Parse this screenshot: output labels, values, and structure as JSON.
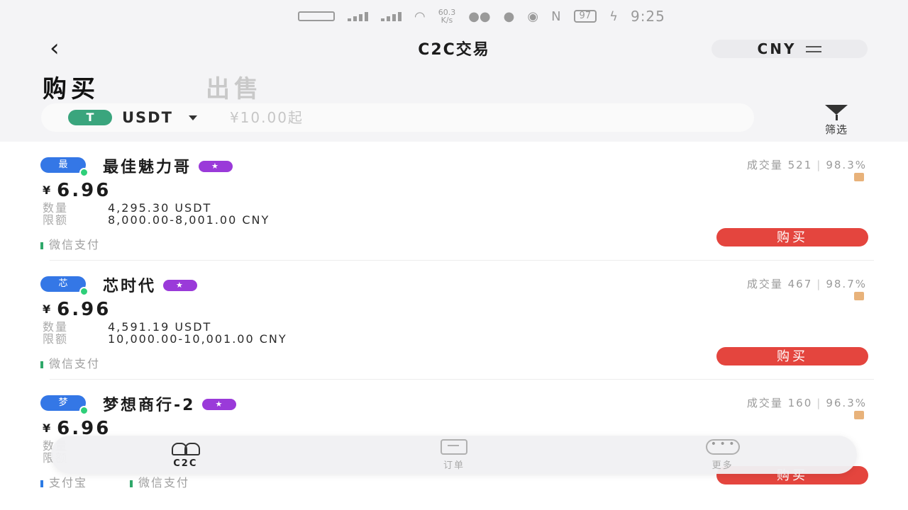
{
  "status_bar": {
    "speed": "60.3",
    "speed_unit": "K/s",
    "battery": "97",
    "time": "9:25"
  },
  "header": {
    "title": "C2C交易",
    "currency": "CNY"
  },
  "tabs": {
    "buy": "购买",
    "sell": "出售"
  },
  "search": {
    "coin_icon_text": "T",
    "coin": "USDT",
    "amount_placeholder": "¥10.00起",
    "filter_label": "筛选"
  },
  "ads": [
    {
      "avatar_text": "最",
      "merchant": "最佳魅力哥",
      "trade_label": "成交量",
      "trades": "521",
      "rate": "98.3%",
      "price_symbol": "¥",
      "price": "6.96",
      "qty_label": "数量",
      "quantity": "4,295.30 USDT",
      "limit_label": "限额",
      "limit": "8,000.00-8,001.00 CNY",
      "payments": [
        "微信支付"
      ],
      "button": "购买"
    },
    {
      "avatar_text": "芯",
      "merchant": "芯时代",
      "trade_label": "成交量",
      "trades": "467",
      "rate": "98.7%",
      "price_symbol": "¥",
      "price": "6.96",
      "qty_label": "数量",
      "quantity": "4,591.19 USDT",
      "limit_label": "限额",
      "limit": "10,000.00-10,001.00 CNY",
      "payments": [
        "微信支付"
      ],
      "button": "购买"
    },
    {
      "avatar_text": "梦",
      "merchant": "梦想商行-2",
      "trade_label": "成交量",
      "trades": "160",
      "rate": "96.3%",
      "price_symbol": "¥",
      "price": "6.96",
      "qty_label": "数量",
      "quantity": "",
      "limit_label": "限额",
      "limit": "",
      "payments": [
        "支付宝",
        "微信支付"
      ],
      "button": "购买"
    }
  ],
  "bottom_nav": [
    {
      "label": "C2C",
      "icon": "people-icon",
      "active": true
    },
    {
      "label": "订单",
      "icon": "order-icon",
      "active": false
    },
    {
      "label": "更多",
      "icon": "more-icon",
      "active": false
    }
  ],
  "colors": {
    "accent_red": "#e4453e",
    "tether_green": "#3aa57d",
    "avatar_blue": "#3477e6",
    "badge_purple": "#9a3ad9"
  }
}
